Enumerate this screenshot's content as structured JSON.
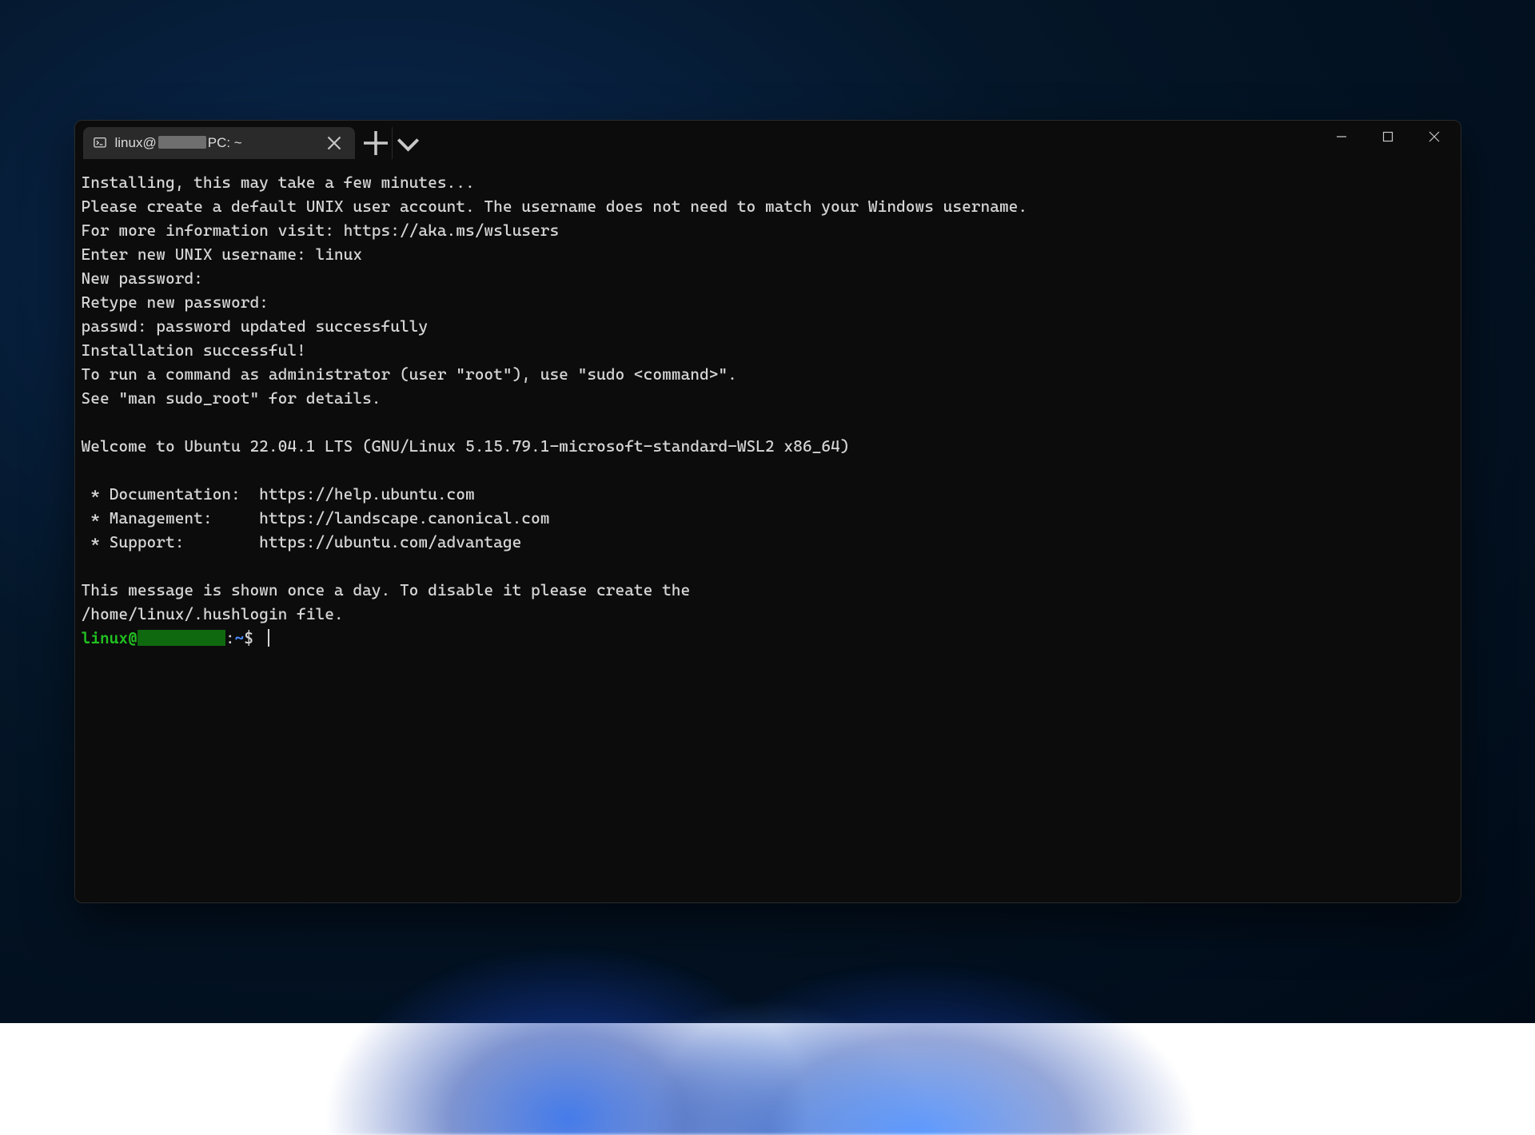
{
  "tab": {
    "title_prefix": "linux@",
    "title_suffix": "PC: ~"
  },
  "terminal": {
    "lines": [
      "Installing, this may take a few minutes...",
      "Please create a default UNIX user account. The username does not need to match your Windows username.",
      "For more information visit: https://aka.ms/wslusers",
      "Enter new UNIX username: linux",
      "New password:",
      "Retype new password:",
      "passwd: password updated successfully",
      "Installation successful!",
      "To run a command as administrator (user \"root\"), use \"sudo <command>\".",
      "See \"man sudo_root\" for details.",
      "",
      "Welcome to Ubuntu 22.04.1 LTS (GNU/Linux 5.15.79.1-microsoft-standard-WSL2 x86_64)",
      "",
      " * Documentation:  https://help.ubuntu.com",
      " * Management:     https://landscape.canonical.com",
      " * Support:        https://ubuntu.com/advantage",
      "",
      "This message is shown once a day. To disable it please create the",
      "/home/linux/.hushlogin file."
    ],
    "prompt": {
      "user": "linux",
      "at": "@",
      "colon": ":",
      "path": "~",
      "symbol": "$"
    }
  }
}
